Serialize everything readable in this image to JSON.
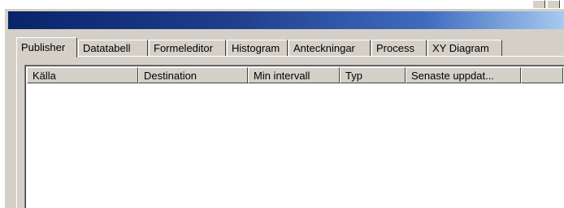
{
  "tabs": [
    {
      "label": "Publisher",
      "active": true
    },
    {
      "label": "Datatabell",
      "active": false
    },
    {
      "label": "Formeleditor",
      "active": false
    },
    {
      "label": "Histogram",
      "active": false
    },
    {
      "label": "Anteckningar",
      "active": false
    },
    {
      "label": "Process",
      "active": false
    },
    {
      "label": "XY Diagram",
      "active": false
    }
  ],
  "table": {
    "columns": [
      "Källa",
      "Destination",
      "Min intervall",
      "Typ",
      "Senaste uppdat...",
      ""
    ],
    "rows": []
  },
  "colors": {
    "title_bar_start": "#0a246a",
    "title_bar_end": "#a6caf0",
    "face": "#d4d0c8"
  }
}
